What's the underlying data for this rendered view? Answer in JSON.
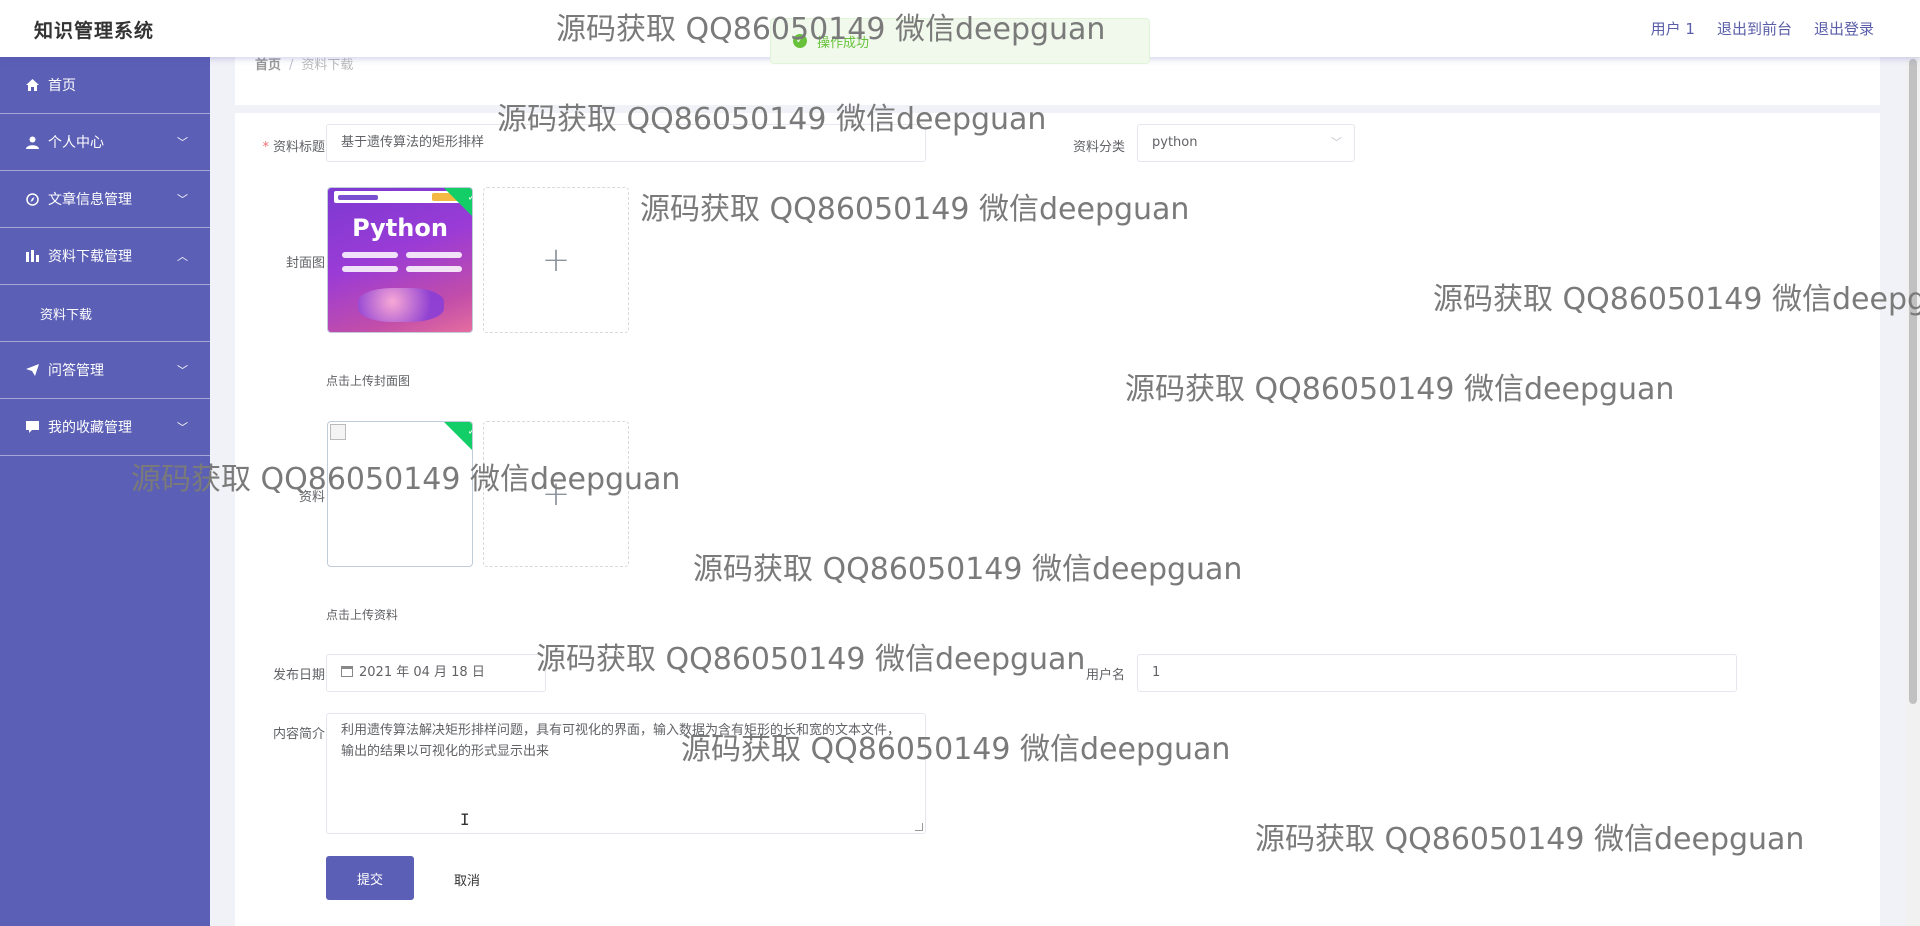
{
  "header": {
    "title": "知识管理系统",
    "links": [
      "用户 1",
      "退出到前台",
      "退出登录"
    ]
  },
  "toast": {
    "text": "操作成功"
  },
  "sidebar": {
    "items": [
      {
        "label": "首页",
        "icon": "home-icon"
      },
      {
        "label": "个人中心",
        "icon": "user-icon"
      },
      {
        "label": "文章信息管理",
        "icon": "compass-icon"
      },
      {
        "label": "资料下载管理",
        "icon": "bar-chart-icon",
        "expanded": true
      },
      {
        "label": "资料下载",
        "icon": ""
      },
      {
        "label": "问答管理",
        "icon": "send-icon"
      },
      {
        "label": "我的收藏管理",
        "icon": "message-icon"
      }
    ]
  },
  "breadcrumb": [
    "首页",
    "资料下载"
  ],
  "form": {
    "title_label": "资料标题",
    "title_value": "基于遗传算法的矩形排样",
    "category_label": "资料分类",
    "category_value": "python",
    "cover_label": "封面图",
    "cover_hint": "点击上传封面图",
    "cover_image_text": "Python",
    "file_label": "资料",
    "file_hint": "点击上传资料",
    "date_label": "发布日期",
    "date_value": "2021 年 04 月 18 日",
    "username_label": "用户名",
    "username_value": "1",
    "intro_label": "内容简介",
    "intro_value": "利用遗传算法解决矩形排样问题，具有可视化的界面，输入数据为含有矩形的长和宽的文本文件，输出的结果以可视化的形式显示出来",
    "submit_label": "提交",
    "cancel_label": "取消"
  },
  "watermark": "源码获取 QQ86050149 微信deepguan",
  "colors": {
    "sidebar": "#5b5fb5",
    "primary": "#5b5fb5",
    "success": "#67c23a",
    "required": "#f56c6c"
  }
}
